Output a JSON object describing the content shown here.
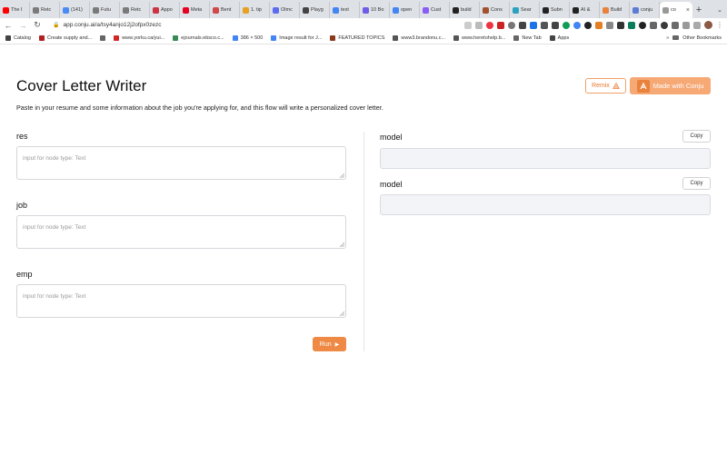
{
  "browser": {
    "tabs": [
      {
        "label": "The I",
        "icon": "youtube-icon",
        "color": "#ff0000"
      },
      {
        "label": "Retc",
        "icon": "doc-icon",
        "color": "#7a7a7a"
      },
      {
        "label": "(141)",
        "icon": "chrome-icon",
        "color": "#4a8af4"
      },
      {
        "label": "Futu",
        "icon": "doc-icon",
        "color": "#7a7a7a"
      },
      {
        "label": "Retc",
        "icon": "doc-icon",
        "color": "#7a7a7a"
      },
      {
        "label": "Appo",
        "icon": "app-icon",
        "color": "#cc3344"
      },
      {
        "label": "Meta",
        "icon": "pinterest-icon",
        "color": "#e60023"
      },
      {
        "label": "Bent",
        "icon": "bento-icon",
        "color": "#d04848"
      },
      {
        "label": "1. tip",
        "icon": "warning-icon",
        "color": "#e8a020"
      },
      {
        "label": "Olmc",
        "icon": "olm-icon",
        "color": "#5b6cf0"
      },
      {
        "label": "Playg",
        "icon": "openai-icon",
        "color": "#444444"
      },
      {
        "label": "text",
        "icon": "google-icon",
        "color": "#4285f4"
      },
      {
        "label": "10 Bo",
        "icon": "bo-icon",
        "color": "#6e5ce6"
      },
      {
        "label": "open",
        "icon": "google-icon",
        "color": "#4285f4"
      },
      {
        "label": "Cust",
        "icon": "cust-icon",
        "color": "#8b5cf6"
      },
      {
        "label": "build",
        "icon": "notion-icon",
        "color": "#222222"
      },
      {
        "label": "Cons",
        "icon": "cons-icon",
        "color": "#a0522d"
      },
      {
        "label": "Sear",
        "icon": "search-g-icon",
        "color": "#2aa1c0"
      },
      {
        "label": "Subn",
        "icon": "sub-icon",
        "color": "#222222"
      },
      {
        "label": "AI &",
        "icon": "notion-icon",
        "color": "#222222"
      },
      {
        "label": "Build",
        "icon": "conju-icon",
        "color": "#e8823d"
      },
      {
        "label": "conju",
        "icon": "conju-icon",
        "color": "#5b7bd5"
      },
      {
        "label": "co",
        "icon": "page-icon",
        "color": "#999999",
        "active": true
      }
    ],
    "new_tab": "+",
    "url": "app.conju.ai/a/tsy4anjo12j2ofpx0zezc",
    "bookmarks": [
      {
        "label": "Catalog",
        "color": "#444444"
      },
      {
        "label": "Create supply and...",
        "color": "#b02020"
      },
      {
        "label": "",
        "color": "#666666"
      },
      {
        "label": "www.yorku.ca/yui...",
        "color": "#d02828"
      },
      {
        "label": "ejournals.ebsco.c...",
        "color": "#3b8a56"
      },
      {
        "label": "386 × 500",
        "color": "#4285f4"
      },
      {
        "label": "Image result for J...",
        "color": "#4285f4"
      },
      {
        "label": "FEATURED TOPICS",
        "color": "#8b3a1e"
      },
      {
        "label": "www3.brandonu.c...",
        "color": "#555555"
      },
      {
        "label": "www.heretohelp.b...",
        "color": "#555555"
      },
      {
        "label": "New Tab",
        "color": "#666666"
      },
      {
        "label": "Apps",
        "color": "#444444"
      }
    ],
    "other_bookmarks": "Other Bookmarks"
  },
  "header": {
    "title": "Cover Letter Writer",
    "subtitle": "Paste in your resume and some information about the job you're applying for, and this flow will write a personalized cover letter.",
    "remix_label": "Remix",
    "made_with_label": "Made with Conju",
    "accent_color": "#ee8a45"
  },
  "inputs": [
    {
      "label": "res",
      "placeholder": "input for node type: Text"
    },
    {
      "label": "job",
      "placeholder": "input for node type: Text"
    },
    {
      "label": "emp",
      "placeholder": "input for node type: Text"
    }
  ],
  "run_label": "Run",
  "outputs": [
    {
      "label": "model",
      "copy_label": "Copy"
    },
    {
      "label": "model",
      "copy_label": "Copy"
    }
  ]
}
